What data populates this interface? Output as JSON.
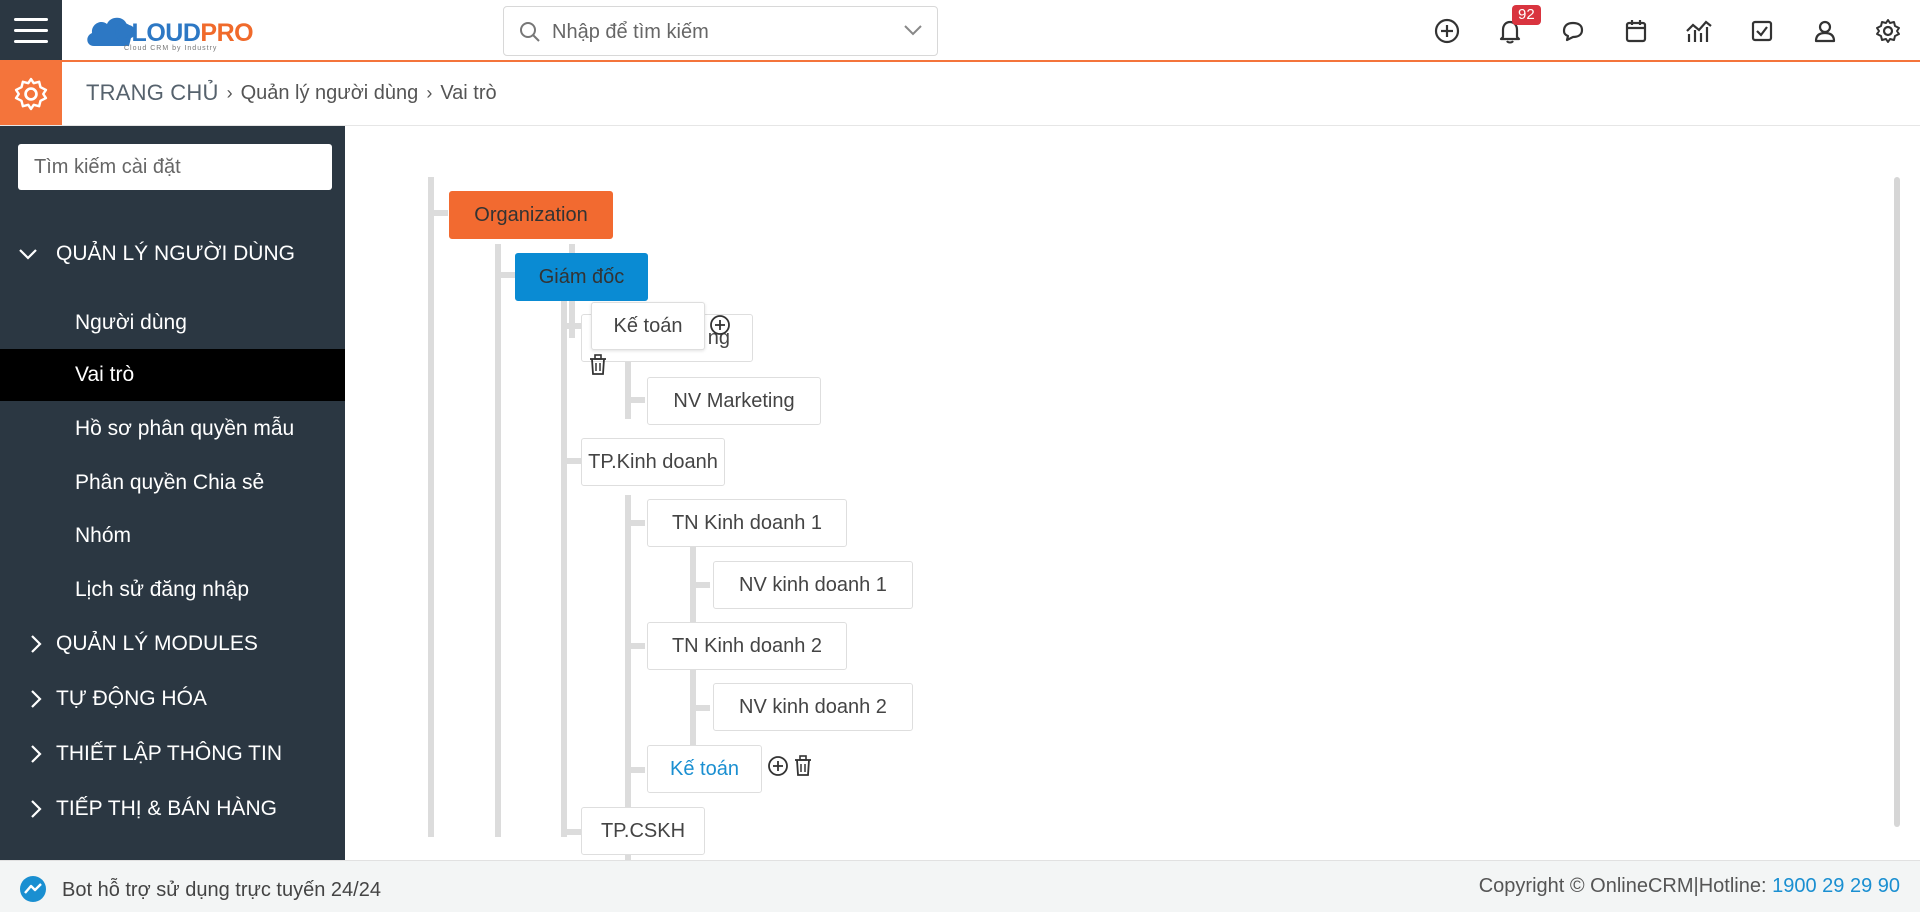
{
  "header": {
    "logo_text_main": "CLOUD",
    "logo_text_accent": "PRO",
    "logo_tagline": "Cloud CRM by Industry",
    "search_placeholder": "Nhập để tìm kiếm",
    "notification_count": "92",
    "icons": [
      "plus-circle-icon",
      "bell-icon",
      "chat-icon",
      "calendar-icon",
      "chart-icon",
      "checkbox-icon",
      "user-icon",
      "gear-icon"
    ]
  },
  "breadcrumb": {
    "home": "TRANG CHỦ",
    "level1": "Quản lý người dùng",
    "level2": "Vai trò"
  },
  "sidebar": {
    "search_placeholder": "Tìm kiếm cài đặt",
    "sections": [
      {
        "label": "QUẢN LÝ NGƯỜI DÙNG",
        "expanded": true,
        "items": [
          {
            "label": "Người dùng",
            "active": false
          },
          {
            "label": "Vai trò",
            "active": true
          },
          {
            "label": "Hồ sơ phân quyền mẫu",
            "active": false
          },
          {
            "label": "Phân quyền Chia sẻ",
            "active": false
          },
          {
            "label": "Nhóm",
            "active": false
          },
          {
            "label": "Lịch sử đăng nhập",
            "active": false
          }
        ]
      },
      {
        "label": "QUẢN LÝ MODULES",
        "expanded": false
      },
      {
        "label": "TỰ ĐỘNG HÓA",
        "expanded": false
      },
      {
        "label": "THIẾT LẬP THÔNG TIN",
        "expanded": false
      },
      {
        "label": "TIẾP THỊ & BÁN HÀNG",
        "expanded": false
      }
    ]
  },
  "tree": {
    "organization": "Organization",
    "giam_doc": "Giám đốc",
    "dragged_node": "Kế toán",
    "hidden_node_fragment": "ng",
    "nv_marketing": "NV Marketing",
    "tp_kinh_doanh": "TP.Kinh doanh",
    "tn_kinh_doanh_1": "TN Kinh doanh 1",
    "nv_kinh_doanh_1": "NV kinh doanh 1",
    "tn_kinh_doanh_2": "TN Kinh doanh 2",
    "nv_kinh_doanh_2": "NV kinh doanh 2",
    "ke_toan": "Kế toán",
    "tp_cskh": "TP.CSKH"
  },
  "footer": {
    "bot_text": "Bot hỗ trợ sử dụng trực tuyến 24/24",
    "copyright": "Copyright © OnlineCRM|Hotline: ",
    "hotline": "1900 29 29 90"
  },
  "colors": {
    "accent_orange": "#f4743b",
    "sidebar_bg": "#2b3742",
    "giam_doc_blue": "#0a8bd3",
    "badge_red": "#d9343f",
    "link_blue": "#1a8fd1"
  }
}
